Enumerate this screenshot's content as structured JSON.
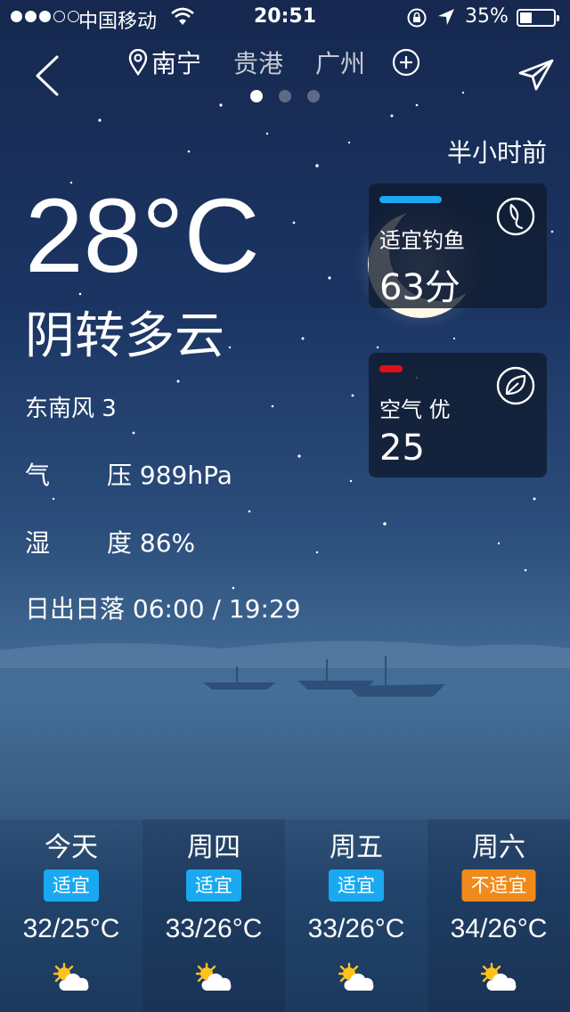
{
  "status_bar": {
    "carrier": "中国移动",
    "time": "20:51",
    "battery": "35%",
    "battery_level": 0.35
  },
  "nav": {
    "cities": [
      {
        "name": "南宁",
        "active": true,
        "icon": "location-pin-icon"
      },
      {
        "name": "贵港",
        "active": false
      },
      {
        "name": "广州",
        "active": false
      }
    ],
    "page_count": 3,
    "active_page": 0
  },
  "current": {
    "updated": "半小时前",
    "temperature": "28°C",
    "condition": "阴转多云",
    "wind": "东南风 3",
    "pressure_label_1": "气",
    "pressure_label_2": "压",
    "pressure_value": "989hPa",
    "humidity_label_1": "湿",
    "humidity_label_2": "度",
    "humidity_value": "86%",
    "sun_label": "日出日落",
    "sun_value": "06:00 / 19:29"
  },
  "cards": {
    "fishing": {
      "label": "适宜钓鱼",
      "value": "63分",
      "bar_color": "#1aa9f0",
      "icon": "fish-icon"
    },
    "air": {
      "label": "空气 优",
      "value": "25",
      "bar_color": "#e0101a",
      "icon": "leaf-icon"
    }
  },
  "forecast": [
    {
      "day": "今天",
      "badge": "适宜",
      "range": "32/25°C",
      "icon": "partly-sunny-icon"
    },
    {
      "day": "周四",
      "badge": "适宜",
      "range": "33/26°C",
      "icon": "partly-sunny-icon"
    },
    {
      "day": "周五",
      "badge": "适宜",
      "range": "33/26°C",
      "icon": "partly-sunny-icon"
    },
    {
      "day": "周六",
      "badge": "不适宜",
      "range": "34/26°C",
      "icon": "partly-sunny-icon"
    }
  ],
  "colors": {
    "suitable": "#1aa9f0",
    "unsuitable": "#f08a1a"
  }
}
